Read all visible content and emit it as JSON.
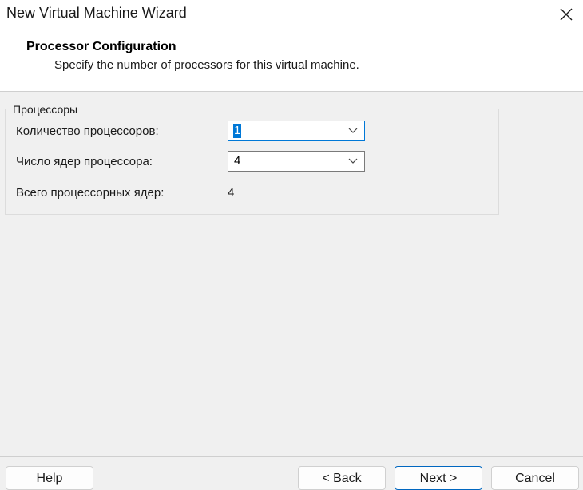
{
  "window": {
    "title": "New Virtual Machine Wizard"
  },
  "header": {
    "title": "Processor Configuration",
    "subtitle": "Specify the number of processors for this virtual machine."
  },
  "processors_group": {
    "legend": "Процессоры",
    "count_label": "Количество процессоров:",
    "count_value": "1",
    "cores_label": "Число ядер процессора:",
    "cores_value": "4",
    "total_label": "Всего процессорных ядер:",
    "total_value": "4"
  },
  "footer": {
    "help_label": "Help",
    "back_label": "< Back",
    "next_label": "Next >",
    "cancel_label": "Cancel"
  },
  "icons": {
    "close": "close-icon",
    "dropdown": "chevron-down-icon"
  },
  "colors": {
    "accent": "#0078d7",
    "dialog_background": "#f0f0f0"
  }
}
